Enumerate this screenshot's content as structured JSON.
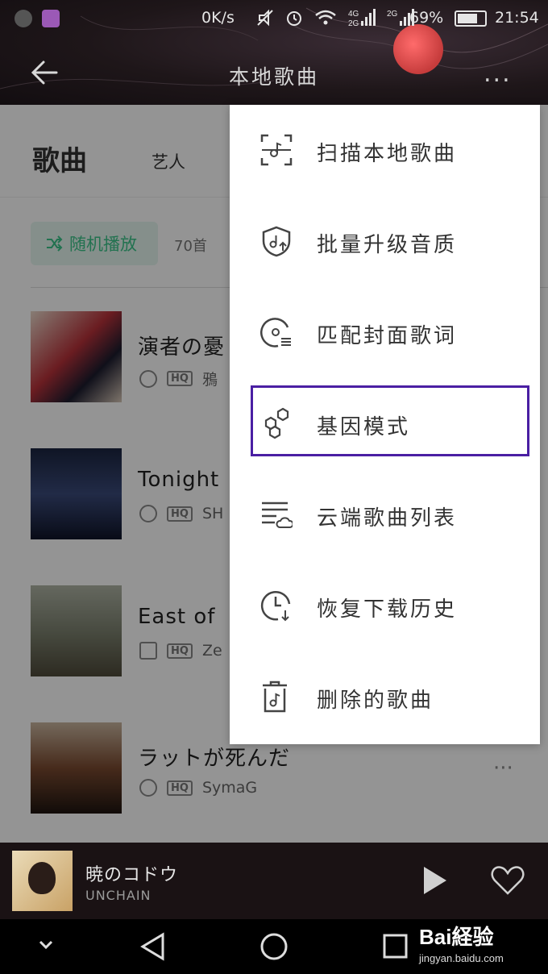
{
  "status_bar": {
    "network_rate": "0K/s",
    "network_labels": [
      "4G",
      "2G",
      "2G"
    ],
    "battery": "69%",
    "time": "21:54"
  },
  "header": {
    "title": "本地歌曲",
    "more": "..."
  },
  "tabs": {
    "songs": "歌曲",
    "artists": "艺人"
  },
  "list": {
    "shuffle_label": "随机播放",
    "count": "70首",
    "songs": [
      {
        "title": "演者の憂",
        "artist": "鴉"
      },
      {
        "title": "Tonight",
        "artist": "SH"
      },
      {
        "title": "East of",
        "artist": "Ze"
      },
      {
        "title": "ラットが死んだ",
        "artist": "SymaG"
      }
    ],
    "quality_badge": "HQ",
    "row_more": "···"
  },
  "menu": {
    "items": [
      {
        "label": "扫描本地歌曲",
        "icon": "scan-music-icon"
      },
      {
        "label": "批量升级音质",
        "icon": "quality-upgrade-icon"
      },
      {
        "label": "匹配封面歌词",
        "icon": "match-cover-lyrics-icon"
      },
      {
        "label": "基因模式",
        "icon": "gene-mode-icon"
      },
      {
        "label": "云端歌曲列表",
        "icon": "cloud-list-icon"
      },
      {
        "label": "恢复下载历史",
        "icon": "restore-history-icon"
      },
      {
        "label": "删除的歌曲",
        "icon": "trash-music-icon"
      }
    ],
    "highlighted_index": 3
  },
  "player": {
    "title": "暁のコドウ",
    "artist": "UNCHAIN"
  },
  "watermark": {
    "brand": "Bai経验",
    "url": "jingyan.baidu.com"
  },
  "colors": {
    "accent": "#3cc58a",
    "highlight": "#4a1fa3",
    "header_bg": "#1e1619",
    "planet": "#d94848"
  }
}
